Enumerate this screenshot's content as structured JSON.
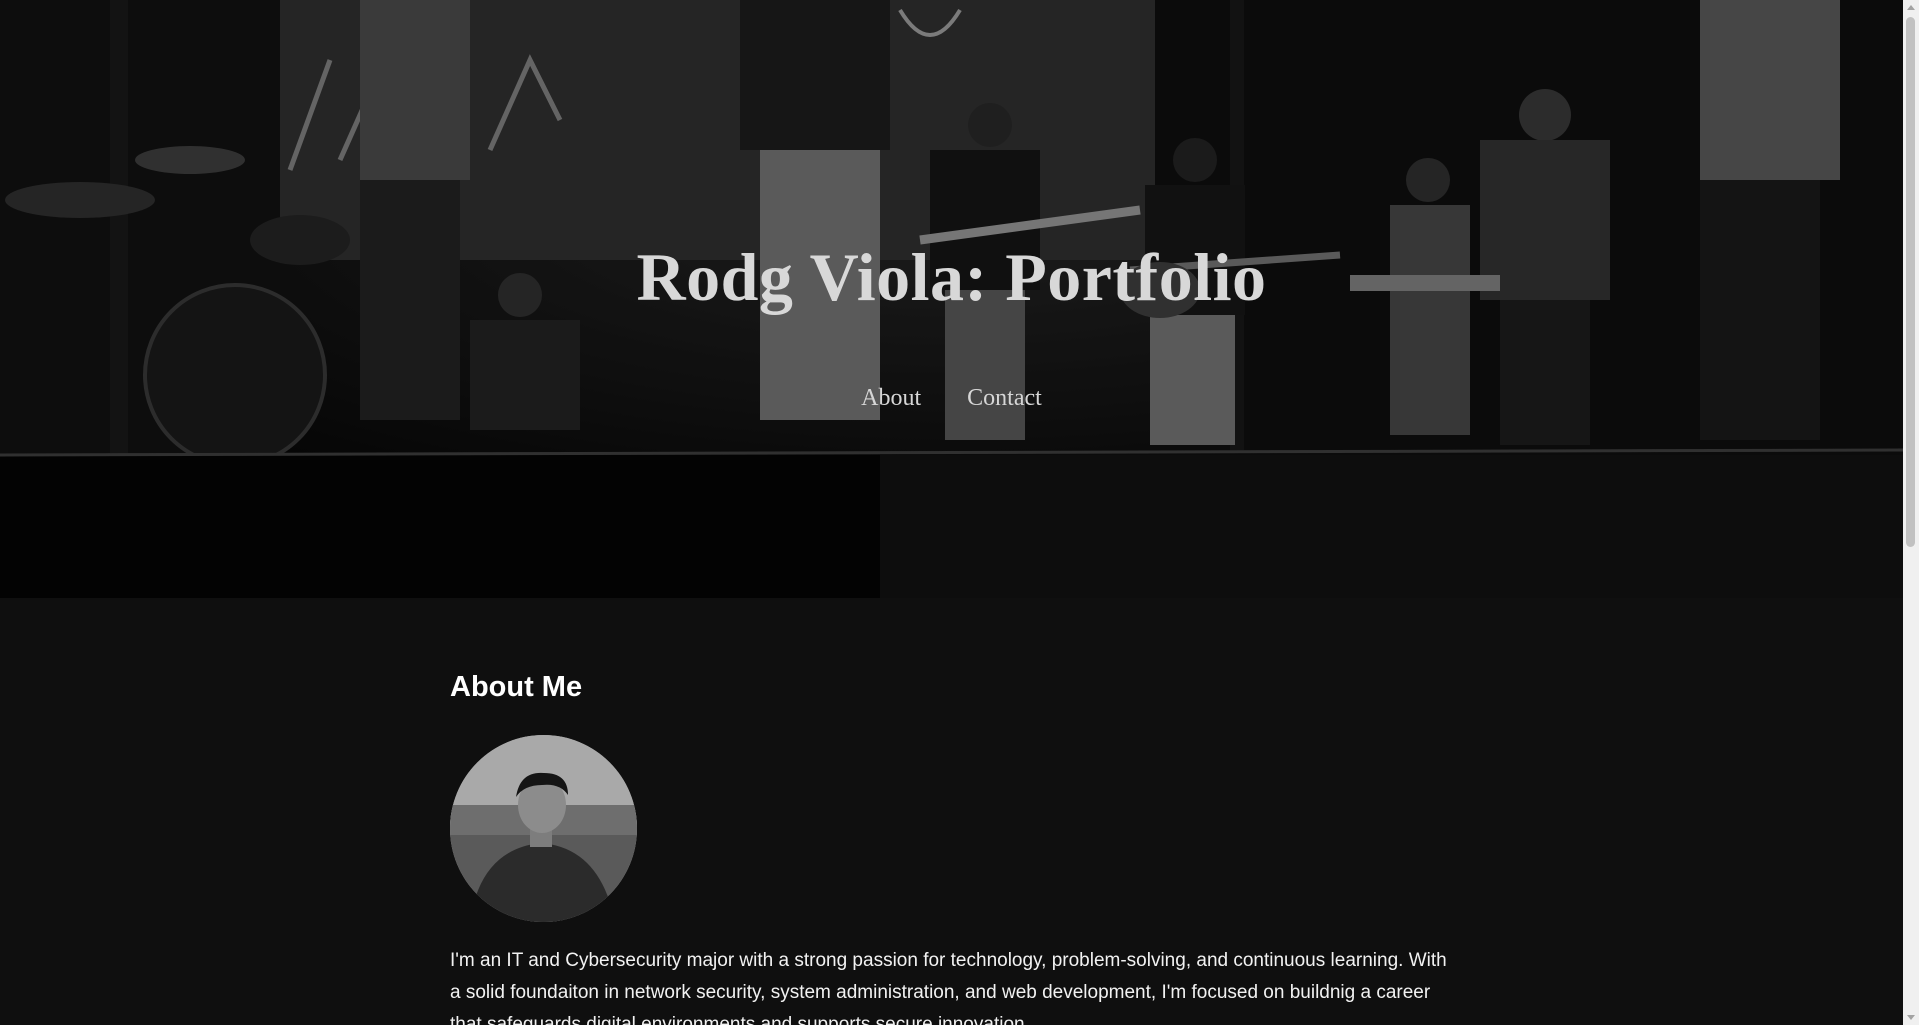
{
  "hero": {
    "title": "Rodg Viola: Portfolio",
    "background_description_icon": "band-stage-photo",
    "nav": [
      {
        "label": "About"
      },
      {
        "label": "Contact"
      }
    ]
  },
  "about": {
    "heading": "About Me",
    "avatar_icon": "profile-photo",
    "paragraph": "I'm an IT and Cybersecurity major with a strong passion for technology, problem-solving, and continuous learning. With a solid foundaiton in network security, system administration, and web development, I'm focused on buildnig a career that safeguards digital environments and supports secure innovation."
  },
  "colors": {
    "page_background": "#0f0f0f",
    "hero_text": "#d8d8d8",
    "body_text": "#f2f2f2",
    "heading_text": "#ffffff"
  },
  "scroll": {
    "position_fraction": 0
  }
}
